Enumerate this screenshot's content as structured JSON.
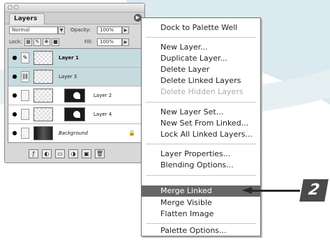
{
  "palette": {
    "tab_label": "Layers",
    "blend_mode": "Normal",
    "opacity_label": "Opacity:",
    "opacity_value": "100%",
    "lock_label": "Lock:",
    "fill_label": "Fill:",
    "fill_value": "100%",
    "layers": [
      {
        "name": "Layer 1",
        "selected": true
      },
      {
        "name": "Layer 3",
        "selected": true
      },
      {
        "name": "Layer 2",
        "selected": false
      },
      {
        "name": "Layer 4",
        "selected": false
      },
      {
        "name": "Background",
        "selected": false
      }
    ]
  },
  "menu": {
    "items": [
      {
        "label": "Dock to Palette Well",
        "state": "normal"
      },
      {
        "label": "New Layer...",
        "state": "normal"
      },
      {
        "label": "Duplicate Layer...",
        "state": "normal"
      },
      {
        "label": "Delete Layer",
        "state": "normal"
      },
      {
        "label": "Delete Linked Layers",
        "state": "normal"
      },
      {
        "label": "Delete Hidden Layers",
        "state": "disabled"
      },
      {
        "label": "New Layer Set...",
        "state": "normal"
      },
      {
        "label": "New Set From Linked...",
        "state": "normal"
      },
      {
        "label": "Lock All Linked Layers...",
        "state": "normal"
      },
      {
        "label": "Layer Properties...",
        "state": "normal"
      },
      {
        "label": "Blending Options...",
        "state": "normal"
      },
      {
        "label": "Merge Linked",
        "state": "highlighted"
      },
      {
        "label": "Merge Visible",
        "state": "normal"
      },
      {
        "label": "Flatten Image",
        "state": "normal"
      },
      {
        "label": "Palette Options...",
        "state": "normal"
      }
    ]
  },
  "callout": {
    "step_number": "2"
  },
  "colors": {
    "highlight": "#666666",
    "selected_layer": "#c6dbe0",
    "swoosh": "#cfe3ea"
  }
}
